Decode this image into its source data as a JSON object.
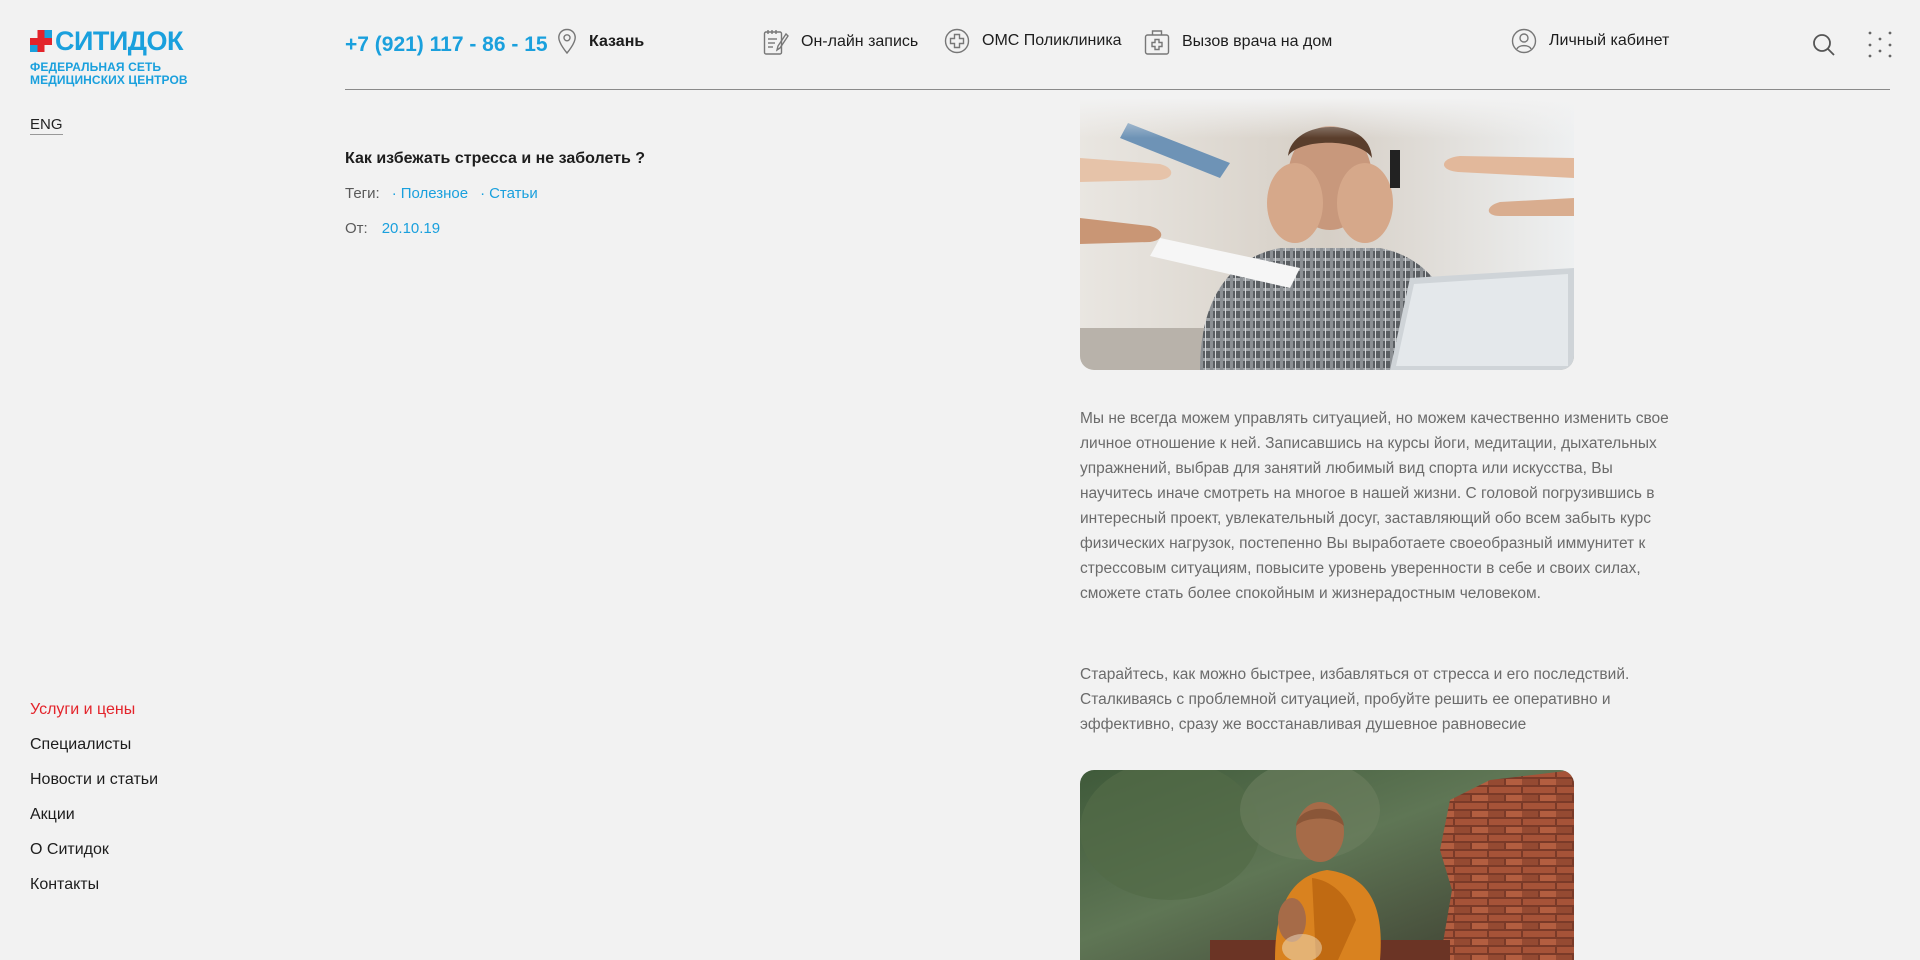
{
  "header": {
    "logo_name": "СИТИДОК",
    "logo_subtitle_line1": "ФЕДЕРАЛЬНАЯ СЕТЬ",
    "logo_subtitle_line2": "МЕДИЦИНСКИХ ЦЕНТРОВ",
    "lang_switch": "ENG",
    "phone": "+7 (921) 117 - 86 - 15",
    "city": "Казань",
    "online_booking": "Он-лайн запись",
    "oms_clinic": "ОМС Поликлиника",
    "doctor_home": "Вызов врача на дом",
    "personal_account": "Личный кабинет"
  },
  "article": {
    "title": "Как избежать стресса и не заболеть ?",
    "tags_label": "Теги:",
    "tags": [
      "Полезное",
      "Статьи"
    ],
    "date_label": "От:",
    "date": "20.10.19",
    "paragraph1": "Мы не всегда можем управлять ситуацией, но можем качественно изменить свое личное отношение к ней. Записавшись на курсы йоги, медитации, дыхательных упражнений, выбрав для занятий любимый вид спорта или искусства, Вы научитесь иначе смотреть на многое в нашей жизни. С головой погрузившись в интересный проект, увлекательный досуг, заставляющий обо всем забыть курс физических нагрузок, постепенно Вы выработаете своеобразный иммунитет к стрессовым ситуациям, повысите уровень уверенности в себе и своих силах, сможете стать более спокойным и жизнерадостным человеком.",
    "paragraph2": "Старайтесь, как можно быстрее, избавляться от стресса и его последствий. Сталкиваясь с проблемной ситуацией, пробуйте решить ее оперативно и эффективно, сразу же восстанавливая душевное равновесие"
  },
  "side_menu": {
    "items": [
      {
        "label": "Услуги и цены"
      },
      {
        "label": "Специалисты"
      },
      {
        "label": "Новости и статьи"
      },
      {
        "label": "Акции"
      },
      {
        "label": "О Ситидок"
      },
      {
        "label": "Контакты"
      }
    ]
  },
  "colors": {
    "brand_blue": "#1aa0dd",
    "brand_red": "#e3242b",
    "background": "#f2f2f2"
  }
}
